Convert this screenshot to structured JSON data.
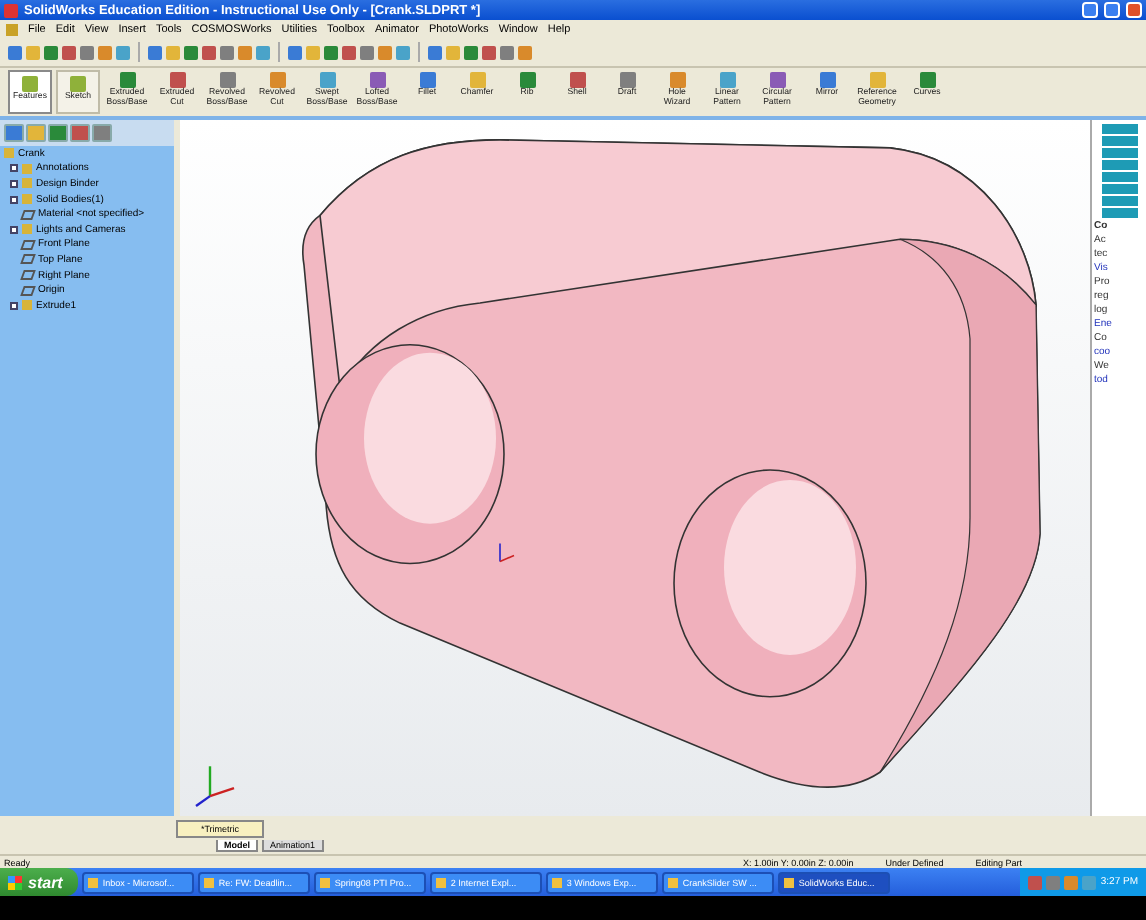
{
  "window": {
    "title": "SolidWorks Education Edition - Instructional Use Only - [Crank.SLDPRT *]"
  },
  "menu": [
    "File",
    "Edit",
    "View",
    "Insert",
    "Tools",
    "COSMOSWorks",
    "Utilities",
    "Toolbox",
    "Animator",
    "PhotoWorks",
    "Window",
    "Help"
  ],
  "feature_toolbar": [
    {
      "label": "Features",
      "selected": true,
      "kind": "tab"
    },
    {
      "label": "Sketch",
      "selected": false,
      "kind": "tab"
    },
    {
      "label": "Extruded Boss/Base",
      "kind": "tool"
    },
    {
      "label": "Extruded Cut",
      "kind": "tool"
    },
    {
      "label": "Revolved Boss/Base",
      "kind": "tool"
    },
    {
      "label": "Revolved Cut",
      "kind": "tool"
    },
    {
      "label": "Swept Boss/Base",
      "kind": "tool"
    },
    {
      "label": "Lofted Boss/Base",
      "kind": "tool"
    },
    {
      "label": "Fillet",
      "kind": "tool"
    },
    {
      "label": "Chamfer",
      "kind": "tool"
    },
    {
      "label": "Rib",
      "kind": "tool"
    },
    {
      "label": "Shell",
      "kind": "tool"
    },
    {
      "label": "Draft",
      "kind": "tool"
    },
    {
      "label": "Hole Wizard",
      "kind": "tool"
    },
    {
      "label": "Linear Pattern",
      "kind": "tool"
    },
    {
      "label": "Circular Pattern",
      "kind": "tool"
    },
    {
      "label": "Mirror",
      "kind": "tool"
    },
    {
      "label": "Reference Geometry",
      "kind": "tool"
    },
    {
      "label": "Curves",
      "kind": "tool"
    }
  ],
  "feature_tree": {
    "root": "Crank",
    "items": [
      {
        "label": "Annotations",
        "kind": "folder"
      },
      {
        "label": "Design Binder",
        "kind": "folder"
      },
      {
        "label": "Solid Bodies(1)",
        "kind": "folder"
      },
      {
        "label": "Material <not specified>",
        "kind": "item"
      },
      {
        "label": "Lights and Cameras",
        "kind": "folder"
      },
      {
        "label": "Front Plane",
        "kind": "item"
      },
      {
        "label": "Top Plane",
        "kind": "item"
      },
      {
        "label": "Right Plane",
        "kind": "item"
      },
      {
        "label": "Origin",
        "kind": "item"
      },
      {
        "label": "Extrude1",
        "kind": "folder"
      }
    ]
  },
  "view": {
    "orientation": "*Trimetric",
    "tabs": [
      {
        "label": "Model",
        "selected": true
      },
      {
        "label": "Animation1",
        "selected": false
      }
    ]
  },
  "task_pane": {
    "lines": [
      {
        "text": "Co",
        "kind": "heading"
      },
      {
        "text": "Ac",
        "kind": "text"
      },
      {
        "text": "tec",
        "kind": "text"
      },
      {
        "text": "Vis",
        "kind": "link"
      },
      {
        "text": "Pro",
        "kind": "text"
      },
      {
        "text": "reg",
        "kind": "text"
      },
      {
        "text": "log",
        "kind": "text"
      },
      {
        "text": "Ene",
        "kind": "link"
      },
      {
        "text": "Co",
        "kind": "text"
      },
      {
        "text": "coo",
        "kind": "link"
      },
      {
        "text": "We",
        "kind": "text"
      },
      {
        "text": "tod",
        "kind": "link"
      }
    ]
  },
  "status_bar": {
    "message": "Ready",
    "coordinates": "X: 1.00in  Y: 0.00in  Z: 0.00in",
    "state": "Under Defined",
    "mode": "Editing Part"
  },
  "taskbar": {
    "start": "start",
    "items": [
      {
        "label": "Inbox - Microsof...",
        "selected": false
      },
      {
        "label": "Re: FW: Deadlin...",
        "selected": false
      },
      {
        "label": "Spring08 PTI Pro...",
        "selected": false
      },
      {
        "label": "2 Internet Expl...",
        "selected": false
      },
      {
        "label": "3 Windows Exp...",
        "selected": false
      },
      {
        "label": "CrankSlider SW ...",
        "selected": false
      },
      {
        "label": "SolidWorks Educ...",
        "selected": true
      }
    ],
    "clock": "3:27 PM"
  }
}
